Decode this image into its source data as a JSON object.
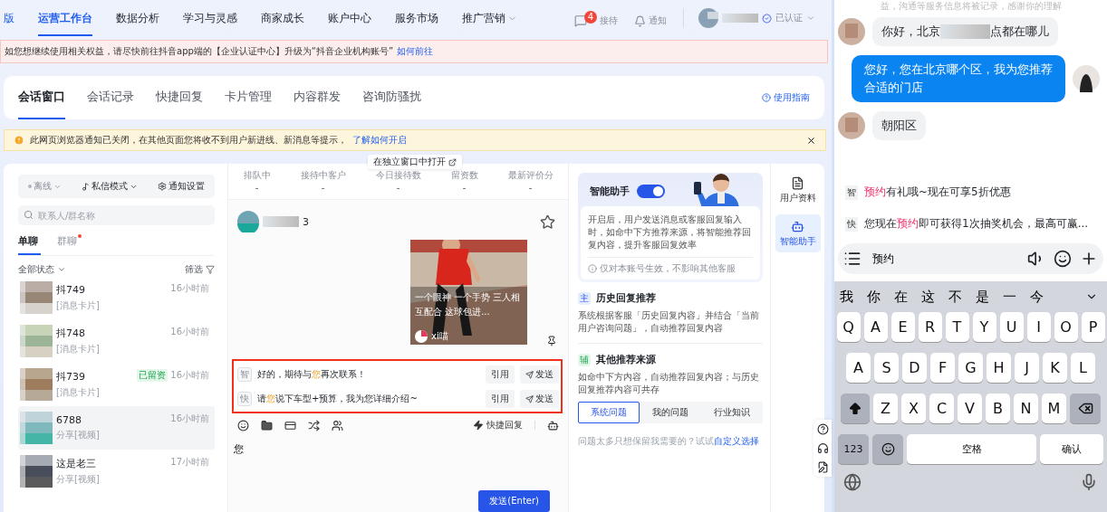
{
  "nav": {
    "brand_fragment": "版",
    "items": [
      {
        "label": "运营工作台",
        "selected": true,
        "dropdown": false
      },
      {
        "label": "数据分析",
        "selected": false,
        "dropdown": false
      },
      {
        "label": "学习与灵感",
        "selected": false,
        "dropdown": false
      },
      {
        "label": "商家成长",
        "selected": false,
        "dropdown": false
      },
      {
        "label": "账户中心",
        "selected": false,
        "dropdown": false
      },
      {
        "label": "服务市场",
        "selected": false,
        "dropdown": false
      },
      {
        "label": "推广营销",
        "selected": false,
        "dropdown": true
      }
    ],
    "actions": [
      {
        "kind": "reception",
        "label": "接待",
        "badge": "4"
      },
      {
        "kind": "notice",
        "label": "通知"
      }
    ],
    "account": {
      "status": "已认证"
    }
  },
  "alert": {
    "text": "如您想继续使用相关权益，请尽快前往抖音app端的【企业认证中心】升级为“抖音企业机构账号”",
    "link": "如何前往"
  },
  "page_tabs": {
    "items": [
      {
        "label": "会话窗口",
        "selected": true
      },
      {
        "label": "会话记录",
        "selected": false
      },
      {
        "label": "快捷回复",
        "selected": false
      },
      {
        "label": "卡片管理",
        "selected": false
      },
      {
        "label": "内容群发",
        "selected": false
      },
      {
        "label": "咨询防骚扰",
        "selected": false
      }
    ],
    "guide": "使用指南"
  },
  "notice": {
    "text": "此网页浏览器通知已关闭，在其他页面您将收不到用户新进线、新消息等提示，",
    "link": "了解如何开启"
  },
  "tooltip": "在独立窗口中打开",
  "contacts": {
    "toolbar": {
      "status": "离线",
      "mode": "私信模式",
      "settings": "通知设置"
    },
    "search": {
      "placeholder": "联系人/群名称"
    },
    "tabs": [
      {
        "label": "单聊",
        "selected": true,
        "unread_dot": false
      },
      {
        "label": "群聊",
        "selected": false,
        "unread_dot": true
      }
    ],
    "filter_status": "全部状态",
    "filter": "筛选",
    "items": [
      {
        "name": "抖749",
        "preview": "[消息卡片]",
        "time": "16小时前",
        "selected": false
      },
      {
        "name": "抖748",
        "preview": "[消息卡片]",
        "time": "16小时前",
        "selected": false
      },
      {
        "name": "抖739",
        "preview": "[消息卡片]",
        "time": "16小时前",
        "tag": "已留资",
        "selected": false
      },
      {
        "name": "6788",
        "preview": "分享[视频]",
        "time": "16小时前",
        "selected": true
      },
      {
        "name": "这是老三",
        "preview": "分享[视频]",
        "time": "17小时前",
        "selected": false
      }
    ]
  },
  "chat": {
    "stats": [
      {
        "label": "排队中",
        "value": "-"
      },
      {
        "label": "接待中客户",
        "value": "-"
      },
      {
        "label": "今日接待数",
        "value": "-"
      },
      {
        "label": "留资数",
        "value": "-"
      },
      {
        "label": "最新评价分",
        "value": "-"
      }
    ],
    "contact_name": "3",
    "video_card": {
      "caption": "一个眼神 一个手势 三人相互配合 这球包进...",
      "author": "xi喵"
    },
    "suggestions": [
      {
        "tag": "智",
        "segments": [
          {
            "text": "好的，期待与",
            "highlight": false
          },
          {
            "text": "您",
            "highlight": true
          },
          {
            "text": "再次联系！",
            "highlight": false
          }
        ],
        "quote": "引用",
        "send": "发送"
      },
      {
        "tag": "快",
        "segments": [
          {
            "text": "请",
            "highlight": false
          },
          {
            "text": "您",
            "highlight": true
          },
          {
            "text": "说下车型+预算，我为您详细介绍~",
            "highlight": false
          }
        ],
        "quote": "引用",
        "send": "发送"
      }
    ],
    "quick_reply": "快捷回复",
    "input": {
      "value": "您"
    },
    "send_button": "发送(Enter)"
  },
  "assistant": {
    "title": "智能助手",
    "on": true,
    "description": "开启后，用户发送消息或客服回复输入时，如命中下方推荐来源，将智能推荐回复内容，提升客服回复效率",
    "note": "仅对本账号生效，不影响其他客服",
    "sections": [
      {
        "badge": "主",
        "kind": "primary",
        "title": "历史回复推荐",
        "description": "系统根据客服「历史回复内容」并结合「当前用户咨询问题」，自动推荐回复内容"
      },
      {
        "badge": "辅",
        "kind": "secondary",
        "title": "其他推荐来源",
        "description": "如命中下方内容，自动推荐回复内容；与历史回复推荐内容可共存"
      }
    ],
    "source_tabs": [
      {
        "label": "系统问题",
        "selected": true
      },
      {
        "label": "我的问题",
        "selected": false
      },
      {
        "label": "行业知识",
        "selected": false
      }
    ],
    "hint": "问题太多只想保留我需要的？试试",
    "hint_link": "自定义选择"
  },
  "side_tabs": [
    {
      "kind": "profile",
      "label": "用户资料",
      "selected": false
    },
    {
      "kind": "assistant",
      "label": "智能助手",
      "selected": true
    }
  ],
  "phone": {
    "top_note": "益，沟通等服务信息将被记录，感谢你的理解",
    "messages": [
      {
        "kind": "incoming",
        "segments": [
          {
            "kind": "text",
            "text": "你好，北京"
          },
          {
            "kind": "redacted"
          },
          {
            "kind": "text",
            "text": "点都在哪儿"
          }
        ]
      },
      {
        "kind": "outgoing",
        "segments": [
          {
            "kind": "text",
            "text": "您好，您在北京哪个区，我为您推荐合适的门店"
          }
        ]
      },
      {
        "kind": "incoming",
        "segments": [
          {
            "kind": "text",
            "text": "朝阳区"
          }
        ]
      }
    ],
    "suggestions": [
      {
        "tag": "智",
        "segments": [
          {
            "text": "预约",
            "highlight": true
          },
          {
            "text": "有礼哦~现在可享5折优惠",
            "highlight": false
          }
        ]
      },
      {
        "tag": "快",
        "segments": [
          {
            "text": "您现在",
            "highlight": false
          },
          {
            "text": "预约",
            "highlight": true
          },
          {
            "text": "即可获得1次抽奖机会，最高可赢...",
            "highlight": false
          }
        ]
      }
    ],
    "input": {
      "value": "预约"
    },
    "keyboard": {
      "candidates": [
        "我",
        "你",
        "在",
        "这",
        "不",
        "是",
        "一",
        "今"
      ],
      "rows": [
        [
          {
            "kind": "letter",
            "label": "Q"
          },
          {
            "kind": "letter",
            "label": "A"
          },
          {
            "kind": "letter",
            "label": "E"
          },
          {
            "kind": "letter",
            "label": "R"
          },
          {
            "kind": "letter",
            "label": "T"
          },
          {
            "kind": "letter",
            "label": "Y"
          },
          {
            "kind": "letter",
            "label": "U"
          },
          {
            "kind": "letter",
            "label": "I"
          },
          {
            "kind": "letter",
            "label": "O"
          },
          {
            "kind": "letter",
            "label": "P"
          }
        ],
        [
          {
            "kind": "letter",
            "label": "A"
          },
          {
            "kind": "letter",
            "label": "S"
          },
          {
            "kind": "letter",
            "label": "D"
          },
          {
            "kind": "letter",
            "label": "F"
          },
          {
            "kind": "letter",
            "label": "G"
          },
          {
            "kind": "letter",
            "label": "H"
          },
          {
            "kind": "letter",
            "label": "J"
          },
          {
            "kind": "letter",
            "label": "K"
          },
          {
            "kind": "letter",
            "label": "L"
          }
        ],
        [
          {
            "kind": "shift"
          },
          {
            "kind": "letter",
            "label": "Z"
          },
          {
            "kind": "letter",
            "label": "X"
          },
          {
            "kind": "letter",
            "label": "C"
          },
          {
            "kind": "letter",
            "label": "V"
          },
          {
            "kind": "letter",
            "label": "B"
          },
          {
            "kind": "letter",
            "label": "N"
          },
          {
            "kind": "letter",
            "label": "M"
          },
          {
            "kind": "backspace"
          }
        ]
      ],
      "bottom_keys": {
        "number": "123",
        "space": "空格",
        "confirm": "确认"
      }
    }
  }
}
